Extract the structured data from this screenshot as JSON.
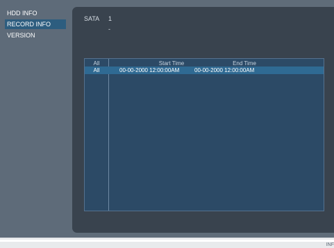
{
  "sidebar": {
    "items": [
      {
        "label": "HDD INFO",
        "active": false
      },
      {
        "label": "RECORD INFO",
        "active": true
      },
      {
        "label": "VERSION",
        "active": false
      }
    ]
  },
  "disk": {
    "label": "SATA",
    "value": "1",
    "sub": "-"
  },
  "table": {
    "headers": [
      "All",
      "Start Time",
      "End Time"
    ],
    "rows": [
      {
        "type": "All",
        "start": "00-00-2000 12:00:00AM",
        "end": "00-00-2000 12:00:00AM"
      }
    ]
  },
  "footer": {
    "text": "INF"
  },
  "colors": {
    "background": "#5f6c79",
    "panel": "#39434e",
    "active_menu": "#2d5d7f",
    "table_bg": "#2c4a66",
    "selected_row": "#2f6a93"
  }
}
